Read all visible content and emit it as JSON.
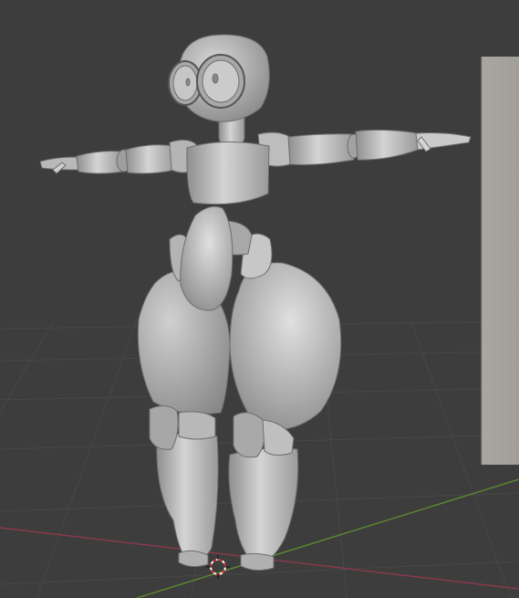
{
  "viewport": {
    "background": "#3d3d3d",
    "grid_color": "#474747",
    "x_axis_color": "#8a3a4a",
    "y_axis_color": "#5e8a2e",
    "plane_color": "#a7a59d",
    "model_color": "#c4c4c4",
    "cursor_colors": [
      "#ffffff",
      "#c83232"
    ]
  },
  "scene": {
    "objects": [
      "robot-character-model",
      "background-plane"
    ],
    "cursor": "3d-cursor-icon"
  }
}
